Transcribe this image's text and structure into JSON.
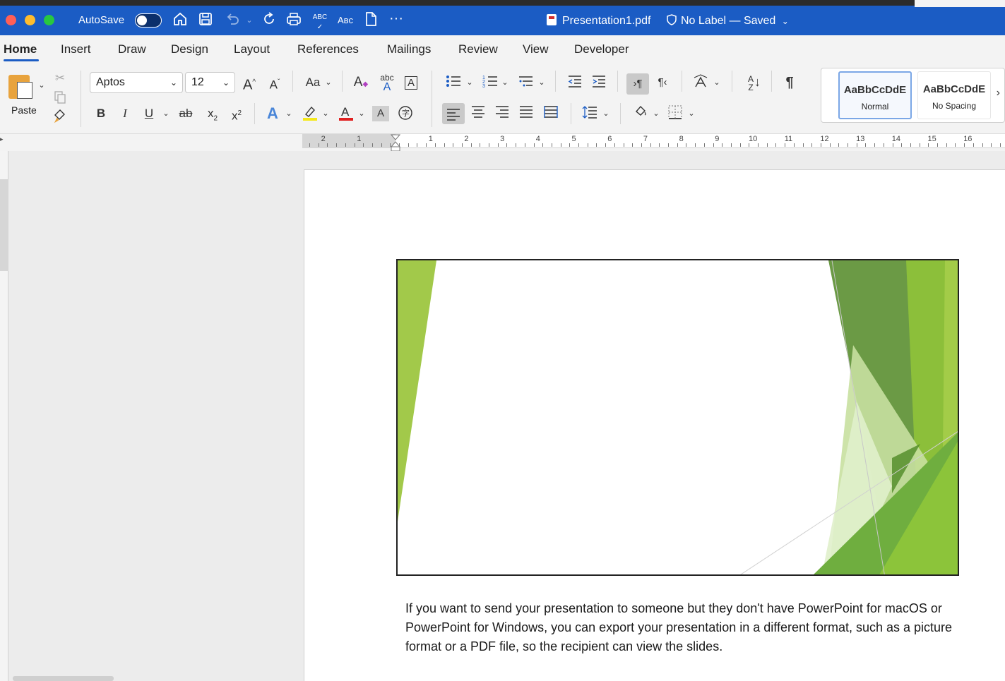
{
  "window": {
    "autosave_label": "AutoSave",
    "doc_title": "Presentation1.pdf",
    "label_status": "No Label — Saved",
    "icons": [
      "home-icon",
      "save-icon",
      "undo-icon",
      "redo-icon",
      "print-icon",
      "spelling-icon",
      "abc-icon",
      "document-icon",
      "more-icon"
    ]
  },
  "tabs": [
    "Home",
    "Insert",
    "Draw",
    "Design",
    "Layout",
    "References",
    "Mailings",
    "Review",
    "View",
    "Developer"
  ],
  "ribbon": {
    "paste_label": "Paste",
    "font_name": "Aptos",
    "font_size": "12",
    "change_case": "Aa",
    "styles": [
      {
        "sample": "AaBbCcDdE",
        "name": "Normal"
      },
      {
        "sample": "AaBbCcDdE",
        "name": "No Spacing"
      }
    ]
  },
  "ruler": {
    "left_numbers": [
      "2",
      "1"
    ],
    "right_numbers": [
      "1",
      "2",
      "3",
      "4",
      "5",
      "6",
      "7",
      "8",
      "9",
      "10",
      "11",
      "12",
      "13",
      "14",
      "15",
      "16"
    ]
  },
  "document": {
    "paragraph": "If you want to send your presentation to someone but they don't have PowerPoint for macOS or PowerPoint for Windows, you can export your presentation in a different format, such as a picture format or a PDF file, so the recipient can view the slides."
  },
  "colors": {
    "titlebar": "#1b5cc4",
    "accent_green": "#8dc63f",
    "dark_green": "#5a9a2a"
  }
}
